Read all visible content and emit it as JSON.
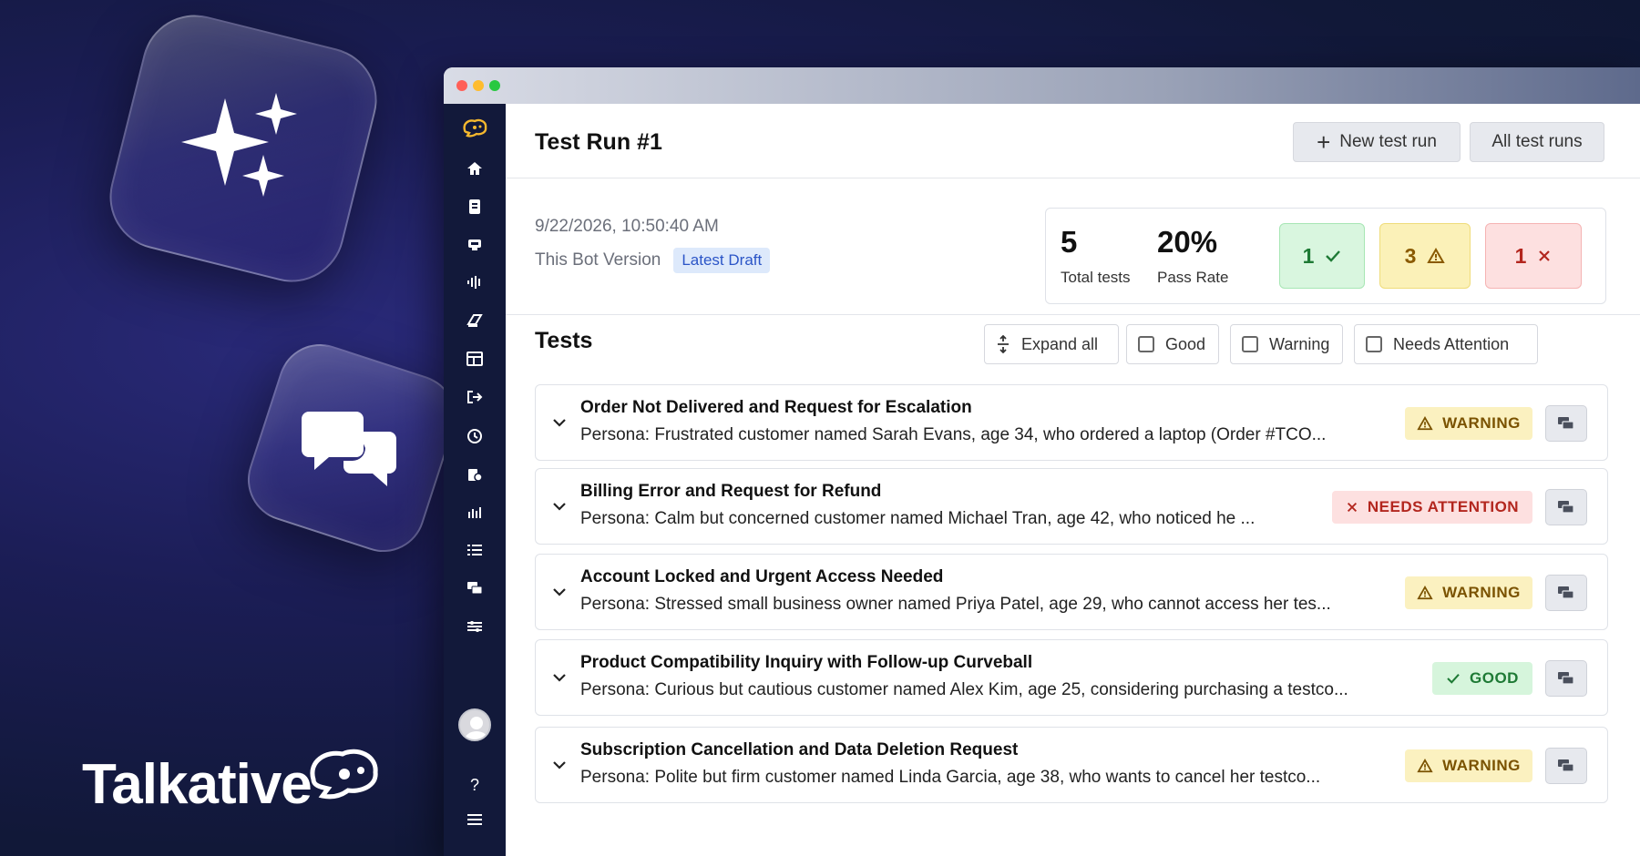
{
  "brand": {
    "name": "Talkative"
  },
  "sidebar": {
    "icons": [
      "logo-icon",
      "home-icon",
      "document-icon",
      "bot-icon",
      "voice-icon",
      "knowledge-icon",
      "layout-icon",
      "handoff-icon",
      "history-icon",
      "settings-icon",
      "analytics-icon",
      "list-icon",
      "chat-icon",
      "tuning-icon",
      "user-avatar",
      "help-icon",
      "menu-icon"
    ],
    "help_label": "?"
  },
  "header": {
    "title": "Test Run #1",
    "new_test_run": "New test run",
    "all_test_runs": "All test runs"
  },
  "summary": {
    "timestamp": "9/22/2026, 10:50:40 AM",
    "bot_version_label": "This Bot Version",
    "bot_version_badge": "Latest Draft",
    "total_tests_value": "5",
    "total_tests_label": "Total tests",
    "pass_rate_value": "20%",
    "pass_rate_label": "Pass Rate",
    "good_count": "1",
    "warning_count": "3",
    "attention_count": "1"
  },
  "tests": {
    "title": "Tests",
    "expand_all": "Expand all",
    "filters": {
      "good": "Good",
      "warning": "Warning",
      "needs_attention": "Needs Attention"
    },
    "rows": [
      {
        "title": "Order Not Delivered and Request for Escalation",
        "persona": "Persona: Frustrated customer named Sarah Evans, age 34, who ordered a laptop (Order #TCO...",
        "status": "WARNING"
      },
      {
        "title": "Billing Error and Request for Refund",
        "persona": "Persona: Calm but concerned customer named Michael Tran, age 42, who noticed he ...",
        "status": "NEEDS ATTENTION"
      },
      {
        "title": "Account Locked and Urgent Access Needed",
        "persona": "Persona: Stressed small business owner named Priya Patel, age 29, who cannot access her tes...",
        "status": "WARNING"
      },
      {
        "title": "Product Compatibility Inquiry with Follow-up Curveball",
        "persona": "Persona: Curious but cautious customer named Alex Kim, age 25, considering purchasing a testco...",
        "status": "GOOD"
      },
      {
        "title": "Subscription Cancellation and Data Deletion Request",
        "persona": "Persona: Polite but firm customer named Linda Garcia, age 38, who wants to cancel her testco...",
        "status": "WARNING"
      }
    ]
  },
  "colors": {
    "warning": "#fbf1c0",
    "attention": "#fde0e0",
    "good": "#d6f5dc",
    "draft_badge": "#dde9fb",
    "sidebar": "#12193a"
  }
}
